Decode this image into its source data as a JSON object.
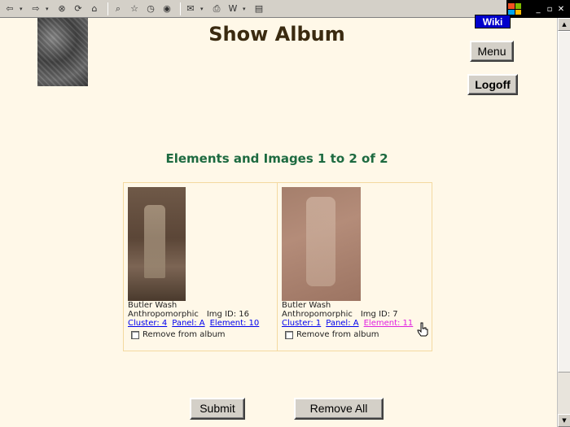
{
  "browser": {
    "toolbar_icons": [
      "back-icon",
      "forward-icon",
      "stop-icon",
      "refresh-icon",
      "home-icon",
      "search-icon",
      "favorites-icon",
      "history-icon",
      "media-icon",
      "mail-icon",
      "print-icon",
      "edit-icon",
      "discuss-icon"
    ],
    "window_controls": [
      "minimize",
      "restore",
      "close"
    ]
  },
  "header": {
    "title": "Show Album",
    "wiki_label": "Wiki",
    "menu_label": "Menu",
    "logoff_label": "Logoff"
  },
  "album": {
    "subheading": "Elements and Images 1 to 2 of 2",
    "items": [
      {
        "location": "Butler Wash",
        "type": "Anthropomorphic",
        "img_id": "Img ID: 16",
        "cluster_link": "Cluster: 4",
        "panel_link": "Panel: A",
        "element_link": "Element: 10",
        "remove_label": "Remove from album"
      },
      {
        "location": "Butler Wash",
        "type": "Anthropomorphic",
        "img_id": "Img ID: 7",
        "cluster_link": "Cluster: 1",
        "panel_link": "Panel: A",
        "element_link": "Element: 11",
        "remove_label": "Remove from album"
      }
    ]
  },
  "actions": {
    "submit_label": "Submit",
    "remove_all_label": "Remove All"
  },
  "colors": {
    "page_bg": "#fff8e8",
    "title": "#3a2a10",
    "subheading": "#1d6a40",
    "link": "#0000ee",
    "visited_link": "#e020e0",
    "wiki_bg": "#0000cc"
  }
}
